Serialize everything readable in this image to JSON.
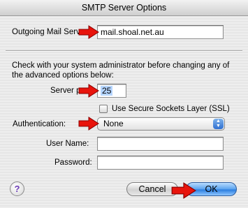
{
  "window": {
    "title": "SMTP Server Options"
  },
  "outgoing": {
    "label": "Outgoing Mail Server:",
    "value": "mail.shoal.net.au"
  },
  "advanced": {
    "note": "Check with your system administrator before changing any of the advanced options below:",
    "server_port_label": "Server port:",
    "server_port_value": "25",
    "ssl_label": "Use Secure Sockets Layer (SSL)",
    "ssl_checked": false,
    "authentication_label": "Authentication:",
    "authentication_value": "None",
    "username_label": "User Name:",
    "username_value": "",
    "password_label": "Password:",
    "password_value": ""
  },
  "buttons": {
    "help": "?",
    "cancel": "Cancel",
    "ok": "OK"
  },
  "icons": {
    "help": "help-icon",
    "popup": "updown-arrows-icon",
    "annotation": "red-arrow-icon"
  },
  "colors": {
    "annotation_arrow": "#e8140c",
    "default_button": "#3b8ae6",
    "selection": "#b5d5ff"
  }
}
